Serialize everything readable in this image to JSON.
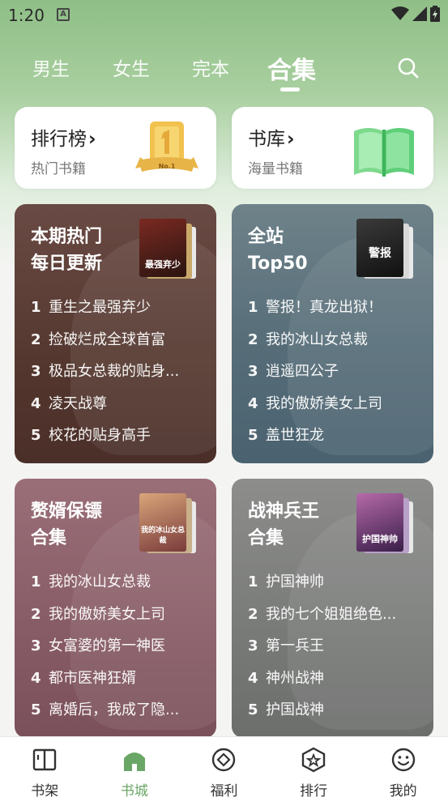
{
  "status_bar": {
    "time": "1:20",
    "badge": "A"
  },
  "tabs": [
    {
      "label": "男生"
    },
    {
      "label": "女生"
    },
    {
      "label": "完本"
    },
    {
      "label": "合集"
    }
  ],
  "top_cards": {
    "ranking": {
      "title": "排行榜",
      "chevron": "›",
      "subtitle": "热门书籍",
      "badge": "No.1"
    },
    "library": {
      "title": "书库",
      "chevron": "›",
      "subtitle": "海量书籍"
    }
  },
  "collections": [
    {
      "title": "本期热门\n每日更新",
      "cover_text": "最强弃少",
      "items": [
        {
          "n": "1",
          "t": "重生之最强弃少"
        },
        {
          "n": "2",
          "t": "捡破烂成全球首富"
        },
        {
          "n": "3",
          "t": "极品女总裁的贴身..."
        },
        {
          "n": "4",
          "t": "凌天战尊"
        },
        {
          "n": "5",
          "t": "校花的贴身高手"
        }
      ]
    },
    {
      "title": "全站\nTop50",
      "cover_text": "警报",
      "items": [
        {
          "n": "1",
          "t": "警报！真龙出狱！"
        },
        {
          "n": "2",
          "t": "我的冰山女总裁"
        },
        {
          "n": "3",
          "t": "逍遥四公子"
        },
        {
          "n": "4",
          "t": "我的傲娇美女上司"
        },
        {
          "n": "5",
          "t": "盖世狂龙"
        }
      ]
    },
    {
      "title": "赘婿保镖\n合集",
      "cover_text": "我的冰山女总裁",
      "items": [
        {
          "n": "1",
          "t": "我的冰山女总裁"
        },
        {
          "n": "2",
          "t": "我的傲娇美女上司"
        },
        {
          "n": "3",
          "t": "女富婆的第一神医"
        },
        {
          "n": "4",
          "t": "都市医神狂婿"
        },
        {
          "n": "5",
          "t": "离婚后，我成了隐..."
        }
      ]
    },
    {
      "title": "战神兵王\n合集",
      "cover_text": "护国神帅",
      "items": [
        {
          "n": "1",
          "t": "护国神帅"
        },
        {
          "n": "2",
          "t": "我的七个姐姐绝色..."
        },
        {
          "n": "3",
          "t": "第一兵王"
        },
        {
          "n": "4",
          "t": "神州战神"
        },
        {
          "n": "5",
          "t": "护国战神"
        }
      ]
    }
  ],
  "bottom_nav": [
    {
      "label": "书架",
      "icon": "book-icon"
    },
    {
      "label": "书城",
      "icon": "home-icon"
    },
    {
      "label": "福利",
      "icon": "gift-diamond-icon"
    },
    {
      "label": "排行",
      "icon": "star-badge-icon"
    },
    {
      "label": "我的",
      "icon": "smile-icon"
    }
  ],
  "colors": {
    "accent": "#6aa665",
    "header_green": "#8fbf86"
  }
}
